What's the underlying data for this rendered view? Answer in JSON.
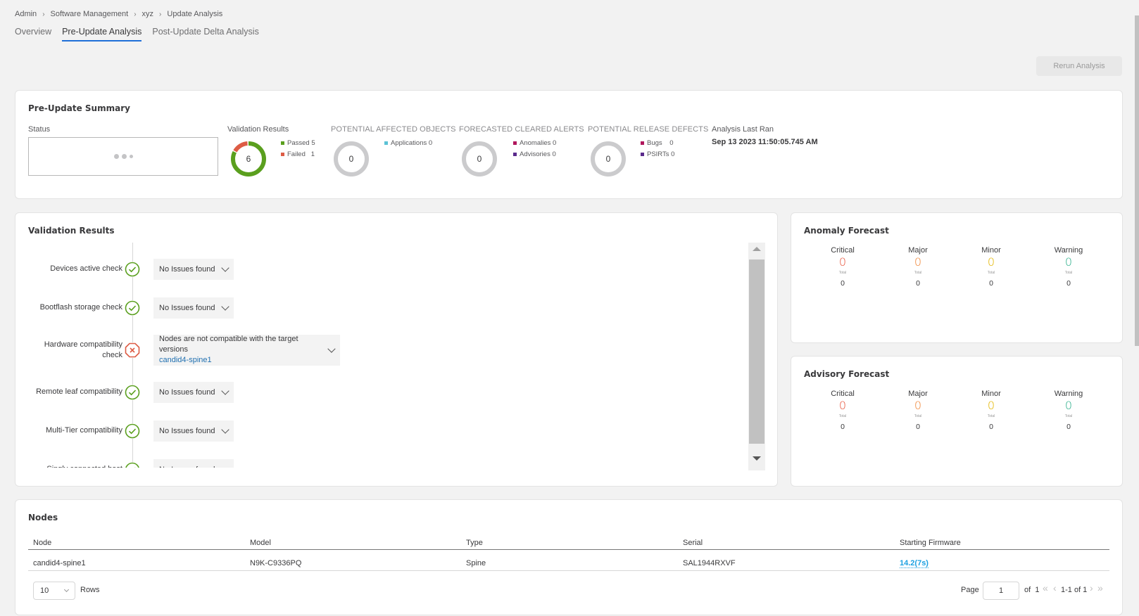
{
  "breadcrumb": [
    "Admin",
    "Software Management",
    "xyz",
    "Update Analysis"
  ],
  "tabs": [
    {
      "label": "Overview",
      "active": false
    },
    {
      "label": "Pre-Update Analysis",
      "active": true
    },
    {
      "label": "Post-Update Delta Analysis",
      "active": false
    }
  ],
  "rerun_label": "Rerun Analysis",
  "summary": {
    "title": "Pre-Update Summary",
    "status_label": "Status",
    "validation": {
      "label": "Validation Results",
      "total": "6",
      "passed_label": "Passed",
      "passed": "5",
      "failed_label": "Failed",
      "failed": "1",
      "passed_color": "#5a9f1e",
      "failed_color": "#dd5c45"
    },
    "affected": {
      "label": "POTENTIAL AFFECTED OBJECTS",
      "total": "0",
      "applications_label": "Applications",
      "applications": "0"
    },
    "cleared": {
      "label": "FORECASTED CLEARED ALERTS",
      "total": "0",
      "anomalies_label": "Anomalies",
      "anomalies": "0",
      "advisories_label": "Advisories",
      "advisories": "0"
    },
    "defects": {
      "label": "POTENTIAL RELEASE DEFECTS",
      "total": "0",
      "bugs_label": "Bugs",
      "bugs": "0",
      "psirts_label": "PSIRTs",
      "psirts": "0"
    },
    "last_ran_label": "Analysis Last Ran",
    "last_ran": "Sep 13 2023 11:50:05.745 AM"
  },
  "validation_results": {
    "title": "Validation Results",
    "items": [
      {
        "label": "Devices active check",
        "status": "pass",
        "result": "No Issues found"
      },
      {
        "label": "Bootflash storage check",
        "status": "pass",
        "result": "No Issues found"
      },
      {
        "label": "Hardware compatibility check",
        "status": "fail",
        "result": "Nodes are not compatible with the target versions",
        "link": "candid4-spine1"
      },
      {
        "label": "Remote leaf compatibility",
        "status": "pass",
        "result": "No Issues found"
      },
      {
        "label": "Multi-Tier compatibility",
        "status": "pass",
        "result": "No Issues found"
      },
      {
        "label": "Singly connected host",
        "status": "pass",
        "result": "No Issues found"
      }
    ]
  },
  "anomaly_forecast": {
    "title": "Anomaly Forecast",
    "columns": [
      {
        "label": "Critical",
        "value": "0",
        "sub": "Total",
        "total": "0",
        "color": "#e8573f"
      },
      {
        "label": "Major",
        "value": "0",
        "sub": "Total",
        "total": "0",
        "color": "#f0873a"
      },
      {
        "label": "Minor",
        "value": "0",
        "sub": "Total",
        "total": "0",
        "color": "#e3b600"
      },
      {
        "label": "Warning",
        "value": "0",
        "sub": "Total",
        "total": "0",
        "color": "#2fb08c"
      }
    ]
  },
  "advisory_forecast": {
    "title": "Advisory Forecast",
    "columns": [
      {
        "label": "Critical",
        "value": "0",
        "sub": "Total",
        "total": "0",
        "color": "#e8573f"
      },
      {
        "label": "Major",
        "value": "0",
        "sub": "Total",
        "total": "0",
        "color": "#f0873a"
      },
      {
        "label": "Minor",
        "value": "0",
        "sub": "Total",
        "total": "0",
        "color": "#e3b600"
      },
      {
        "label": "Warning",
        "value": "0",
        "sub": "Total",
        "total": "0",
        "color": "#2fb08c"
      }
    ]
  },
  "nodes": {
    "title": "Nodes",
    "columns": [
      "Node",
      "Model",
      "Type",
      "Serial",
      "Starting Firmware"
    ],
    "rows": [
      [
        "candid4-spine1",
        "N9K-C9336PQ",
        "Spine",
        "SAL1944RXVF",
        "14.2(7s)"
      ]
    ],
    "rows_per_page": "10",
    "rows_label": "Rows",
    "page_label": "Page",
    "page": "1",
    "of_label": "of",
    "total_pages": "1",
    "range": "1-1 of 1"
  }
}
